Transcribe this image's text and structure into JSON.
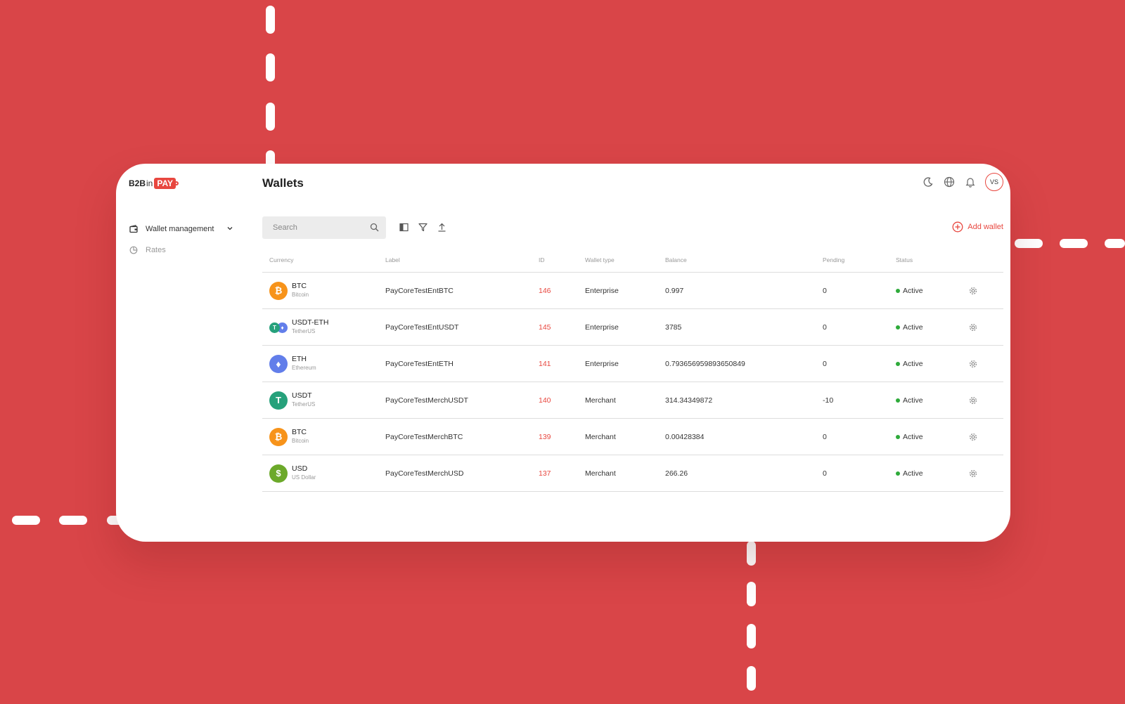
{
  "colors": {
    "background": "#d94548",
    "accent": "#e8473f",
    "active": "#2eaa3a"
  },
  "logo": {
    "b2b": "B2B",
    "in": "in",
    "pay": "PAY"
  },
  "sidebar": {
    "items": [
      {
        "label": "Wallet management",
        "icon": "wallet-icon"
      },
      {
        "label": "Rates",
        "icon": "pie-chart-icon"
      }
    ]
  },
  "header": {
    "title": "Wallets",
    "icons": [
      "moon-icon",
      "globe-icon",
      "bell-icon"
    ],
    "avatar": "VS"
  },
  "toolbar": {
    "search_placeholder": "Search",
    "icons": [
      "columns-icon",
      "filter-icon",
      "export-icon"
    ],
    "add_wallet_label": "Add wallet"
  },
  "table": {
    "columns": [
      "Currency",
      "Label",
      "ID",
      "Wallet type",
      "Balance",
      "Pending",
      "Status"
    ],
    "rows": [
      {
        "symbol": "BTC",
        "name": "Bitcoin",
        "icon": "bitcoin-icon",
        "label": "PayCoreTestEntBTC",
        "id": "146",
        "type": "Enterprise",
        "balance": "0.997",
        "pending": "0",
        "status": "Active"
      },
      {
        "symbol": "USDT-ETH",
        "name": "TetherUS",
        "icon": "tether-ethereum-icon",
        "label": "PayCoreTestEntUSDT",
        "id": "145",
        "type": "Enterprise",
        "balance": "3785",
        "pending": "0",
        "status": "Active"
      },
      {
        "symbol": "ETH",
        "name": "Ethereum",
        "icon": "ethereum-icon",
        "label": "PayCoreTestEntETH",
        "id": "141",
        "type": "Enterprise",
        "balance": "0.793656959893650849",
        "pending": "0",
        "status": "Active"
      },
      {
        "symbol": "USDT",
        "name": "TetherUS",
        "icon": "tether-icon",
        "label": "PayCoreTestMerchUSDT",
        "id": "140",
        "type": "Merchant",
        "balance": "314.34349872",
        "pending": "-10",
        "status": "Active"
      },
      {
        "symbol": "BTC",
        "name": "Bitcoin",
        "icon": "bitcoin-icon",
        "label": "PayCoreTestMerchBTC",
        "id": "139",
        "type": "Merchant",
        "balance": "0.00428384",
        "pending": "0",
        "status": "Active"
      },
      {
        "symbol": "USD",
        "name": "US Dollar",
        "icon": "dollar-icon",
        "label": "PayCoreTestMerchUSD",
        "id": "137",
        "type": "Merchant",
        "balance": "266.26",
        "pending": "0",
        "status": "Active"
      }
    ]
  }
}
